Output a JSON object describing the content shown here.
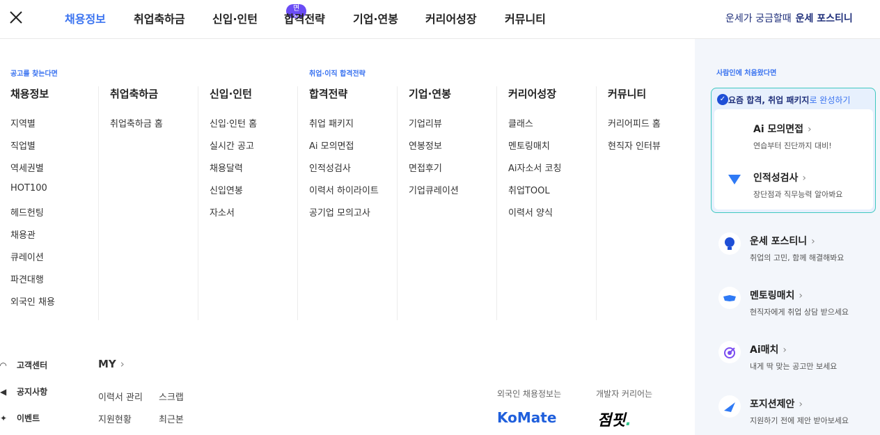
{
  "topbar": {
    "nav": [
      {
        "label": "채용정보",
        "active": true
      },
      {
        "label": "취업축하금"
      },
      {
        "label": "신입·인턴"
      },
      {
        "label": "합격전략"
      },
      {
        "label": "기업·연봉"
      },
      {
        "label": "커리어성장"
      },
      {
        "label": "커뮤니티"
      }
    ],
    "badge": "면접공·합격",
    "fortune_prefix": "운세가 궁금할때",
    "fortune_name": "운세 포스티니"
  },
  "sections": {
    "find_job": "공고를 찾는다면",
    "strategy": "취업·이직 합격전략"
  },
  "columns": [
    {
      "title": "채용정보",
      "items": [
        "지역별",
        "직업별",
        "역세권별",
        "HOT100",
        "헤드헌팅",
        "채용관",
        "큐레이션",
        "파견대행",
        "외국인 채용"
      ]
    },
    {
      "title": "취업축하금",
      "items": [
        "취업축하금 홈"
      ]
    },
    {
      "title": "신입·인턴",
      "items": [
        "신입·인턴 홈",
        "실시간 공고",
        "채용달력",
        "신입연봉",
        "자소서"
      ]
    },
    {
      "title": "합격전략",
      "items": [
        "취업 패키지",
        "Ai 모의면접",
        "인적성검사",
        "이력서 하이라이트",
        "공기업 모의고사"
      ]
    },
    {
      "title": "기업·연봉",
      "items": [
        "기업리뷰",
        "연봉정보",
        "면접후기",
        "기업큐레이션"
      ]
    },
    {
      "title": "커리어성장",
      "items": [
        "클래스",
        "멘토링매치",
        "Ai자소서 코칭",
        "취업TOOL",
        "이력서 양식"
      ]
    },
    {
      "title": "커뮤니티",
      "items": [
        "커리어피드 홈",
        "현직자 인터뷰"
      ]
    }
  ],
  "bottom": {
    "support": [
      {
        "label": "고객센터",
        "icon": "headset-icon"
      },
      {
        "label": "공지사항",
        "icon": "megaphone-icon"
      },
      {
        "label": "이벤트",
        "icon": "party-icon"
      }
    ],
    "my_title": "MY",
    "my_links": [
      "이력서 관리",
      "스크랩",
      "지원현황",
      "최근본"
    ],
    "foreign_label": "외국인 채용정보는",
    "dev_label": "개발자 커리어는",
    "komate": "KoMate",
    "jobpeak": "점핏",
    "jobpeak_dot": "."
  },
  "right_panel": {
    "eyebrow": "사람인에 처음왔다면",
    "package_head": "요즘 합격, 취업 패키지",
    "package_head_accent": "로 완성하기",
    "package_cards": [
      {
        "title": "Ai 모의면접",
        "sub": "연습부터 진단까지 대비!"
      },
      {
        "title": "인적성검사",
        "sub": "장단점과 직무능력 알아봐요"
      }
    ],
    "cards": [
      {
        "title": "운세 포스티니",
        "sub": "취업의 고민, 함께 해결해봐요"
      },
      {
        "title": "멘토링매치",
        "sub": "현직자에게 취업 상담 받으세요"
      },
      {
        "title": "Ai매치",
        "sub": "내게 딱 맞는 공고만 보세요"
      },
      {
        "title": "포지션제안",
        "sub": "지원하기 전에 제안 받아보세요"
      }
    ],
    "chevron": "›"
  },
  "colors": {
    "accent": "#3a73f0",
    "badge": "#6a4cf5",
    "navy": "#1f2f7a"
  }
}
